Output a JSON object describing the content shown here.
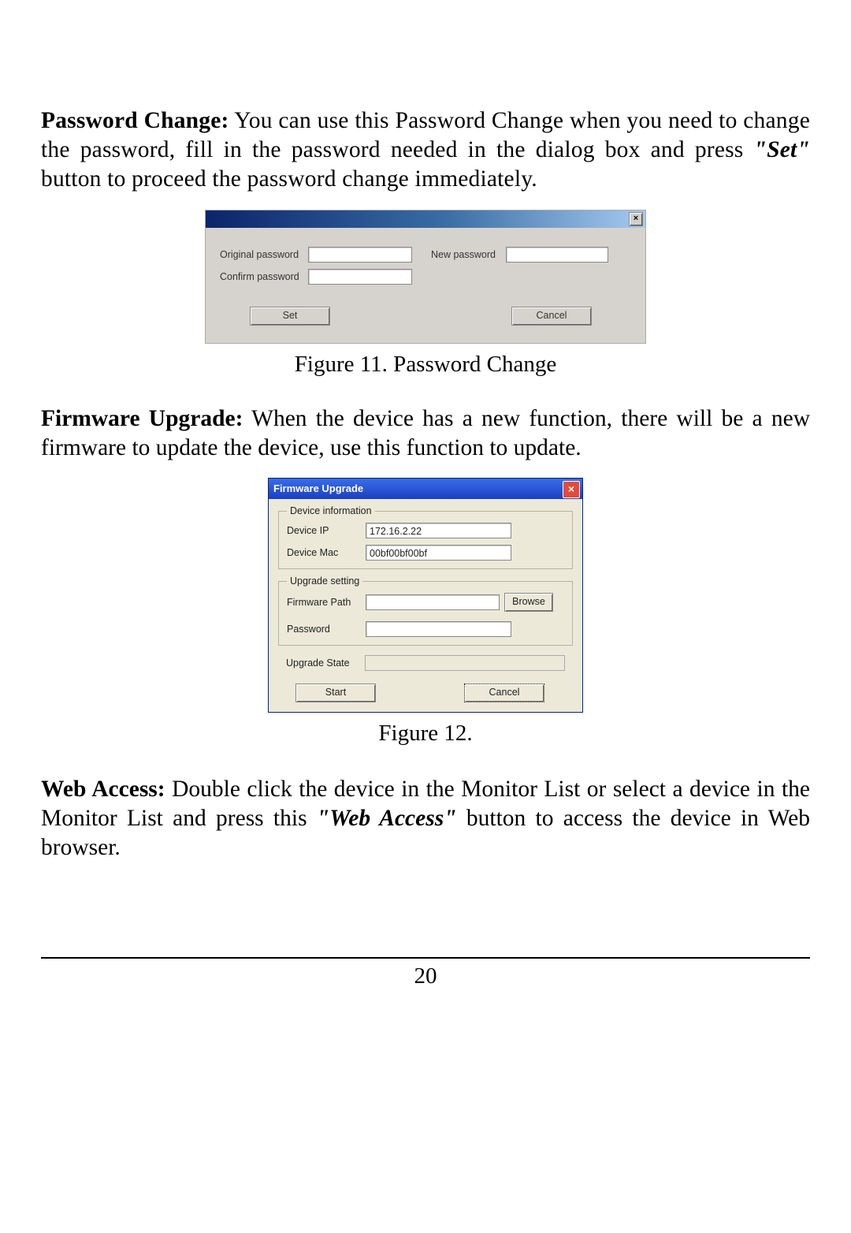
{
  "paragraphs": {
    "password_change_heading": "Password Change:",
    "password_change_body1": " You can use this Password Change when you need to change the password, fill in the password needed in the dialog box and press ",
    "password_change_set_quote": "\"Set\"",
    "password_change_body2": " button to proceed the password change immediately.",
    "firmware_heading": "Firmware Upgrade:",
    "firmware_body": " When the device has a new function, there will be a new firmware to update the device, use this function to update.",
    "webaccess_heading": "Web Access:",
    "webaccess_body1": " Double click the device in the Monitor List or select a device in the Monitor List and press this ",
    "webaccess_quote": "\"Web Access\"",
    "webaccess_body2": " button to access the device in Web browser."
  },
  "captions": {
    "fig11": "Figure 11. Password Change",
    "fig12": "Figure 12."
  },
  "pw_dialog": {
    "close_glyph": "×",
    "labels": {
      "original": "Original password",
      "new": "New password",
      "confirm": "Confirm password"
    },
    "values": {
      "original": "",
      "new": "",
      "confirm": ""
    },
    "buttons": {
      "set": "Set",
      "cancel": "Cancel"
    }
  },
  "fw_dialog": {
    "title": "Firmware Upgrade",
    "close_glyph": "×",
    "groups": {
      "device_info": "Device information",
      "upgrade_setting": "Upgrade setting"
    },
    "labels": {
      "device_ip": "Device IP",
      "device_mac": "Device Mac",
      "firmware_path": "Firmware Path",
      "password": "Password",
      "upgrade_state": "Upgrade State"
    },
    "values": {
      "device_ip": "172.16.2.22",
      "device_mac": "00bf00bf00bf",
      "firmware_path": "",
      "password": ""
    },
    "buttons": {
      "browse": "Browse",
      "start": "Start",
      "cancel": "Cancel"
    }
  },
  "page_number": "20"
}
